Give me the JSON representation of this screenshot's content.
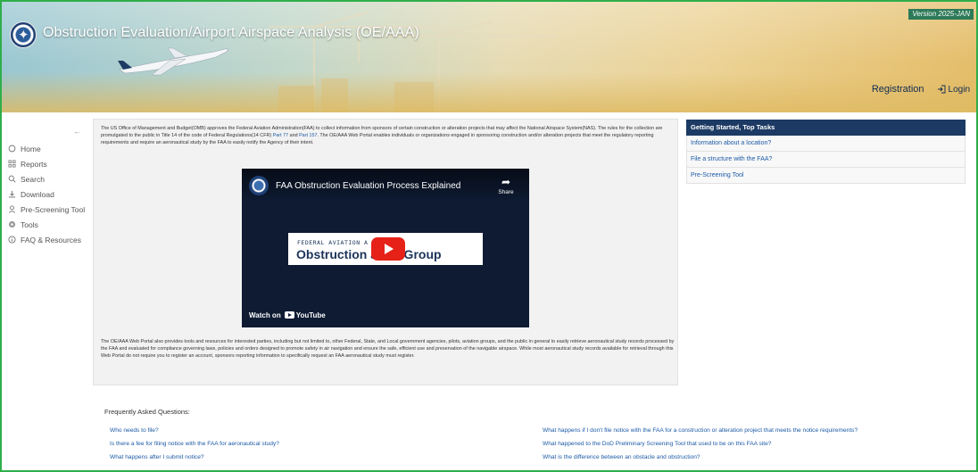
{
  "header": {
    "app_title": "Obstruction Evaluation/Airport Airspace Analysis (OE/AAA)",
    "version": "Version 2025-JAN",
    "nav": {
      "registration": "Registration",
      "login": "Login"
    }
  },
  "sidebar": {
    "collapse_glyph": "←",
    "items": [
      {
        "label": "Home",
        "icon": "home-icon"
      },
      {
        "label": "Reports",
        "icon": "grid-icon"
      },
      {
        "label": "Search",
        "icon": "search-icon"
      },
      {
        "label": "Download",
        "icon": "download-icon"
      },
      {
        "label": "Pre-Screening Tool",
        "icon": "person-icon"
      },
      {
        "label": "Tools",
        "icon": "gear-icon"
      },
      {
        "label": "FAQ & Resources",
        "icon": "info-icon"
      }
    ]
  },
  "main": {
    "intro_before_link": "The US Office of Management and Budget(OMB) approves the Federal Aviation Administration(FAA) to collect information from sponsors of certain construction or alteration projects that may affect the National Airspace System(NAS). The rules for the collection are promulgated to the public in Title 14 of the code of Federal Regulations(14 CFR)",
    "link_part77": "Part 77",
    "and_text": "and",
    "link_part157": "Part 157",
    "intro_after_link": ". The OE/AAA Web Portal enables individuals or organizations engaged in sponsoring construction and/or alteration projects that meet the regulatory reporting requirements and require an aeronautical study by the FAA to easily notify the Agency of their intent.",
    "video": {
      "title": "FAA Obstruction Evaluation Process Explained",
      "share": "Share",
      "banner_line1": "FEDERAL AVIATION A         TION'S",
      "banner_line2": "Obstruction         ation Group",
      "watch_on": "Watch on",
      "youtube": "YouTube"
    },
    "second_paragraph": "The OE/AAA Web Portal also provides tools and resources for interested parties, including but not limited to, other Federal, State, and Local government agencies, pilots, aviation groups, and the public in general to easily retrieve aeronautical study records processed by the FAA and evaluated for compliance governing laws, policies and orders designed to promote safety in air navigation and ensure the safe, efficient use and preservation of the navigable airspace. While most aeronautical study records available for retrieval through this Web Portal do not require you to register an account, sponsors reporting information to specifically request an FAA aeronautical study must register."
  },
  "tasks": {
    "header": "Getting Started, Top Tasks",
    "items": [
      "Information about a location?",
      "File a structure with the FAA?",
      "Pre-Screening Tool"
    ]
  },
  "faq": {
    "title": "Frequently Asked Questions:",
    "left": [
      "Who needs to file?",
      "Is there a fee for filing notice with the FAA for aeronautical study?",
      "What happens after I submit notice?"
    ],
    "right": [
      "What happens if I don't file notice with the FAA for a construction or alteration project that meets the notice requirements?",
      "What happened to the DoD Preliminary Screening Tool that used to be on this FAA site?",
      "What is the difference between an obstacle and obstruction?"
    ]
  },
  "colors": {
    "frame_border": "#2fae4a",
    "header_navy": "#1c3a63",
    "link_blue": "#1c5aa6",
    "version_badge": "#2d7a58"
  }
}
